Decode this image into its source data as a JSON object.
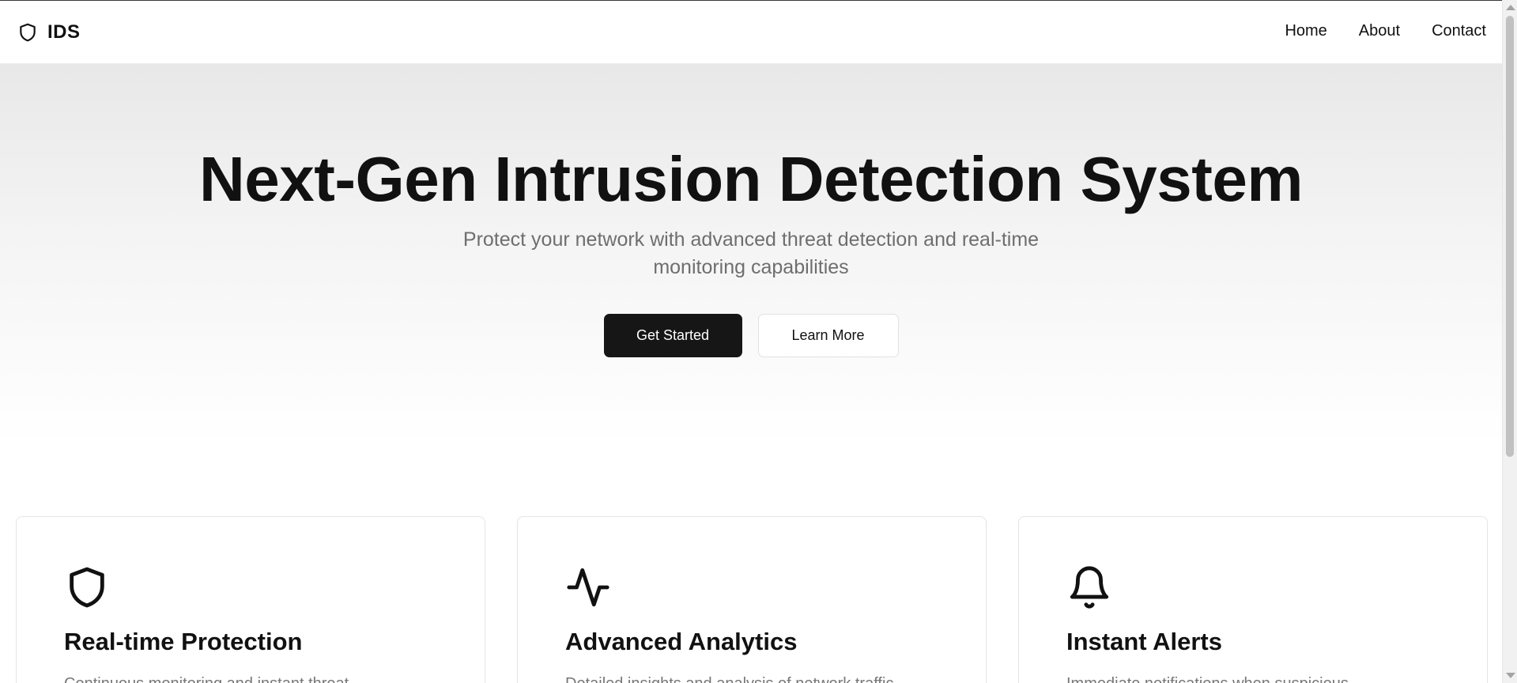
{
  "brand": {
    "name": "IDS",
    "icon": "shield-icon"
  },
  "nav": {
    "links": [
      "Home",
      "About",
      "Contact"
    ]
  },
  "hero": {
    "title": "Next-Gen Intrusion Detection System",
    "subtitle": "Protect your network with advanced threat detection and real-time monitoring capabilities",
    "primary_button": "Get Started",
    "secondary_button": "Learn More"
  },
  "features": [
    {
      "icon": "shield-icon",
      "title": "Real-time Protection",
      "description": "Continuous monitoring and instant threat..."
    },
    {
      "icon": "activity-icon",
      "title": "Advanced Analytics",
      "description": "Detailed insights and analysis of network traffic..."
    },
    {
      "icon": "bell-icon",
      "title": "Instant Alerts",
      "description": "Immediate notifications when suspicious..."
    }
  ],
  "colors": {
    "primary_button_bg": "#161616",
    "text": "#111111",
    "muted_text": "#6e6e6e",
    "hero_gradient_top": "#e8e8e8"
  }
}
